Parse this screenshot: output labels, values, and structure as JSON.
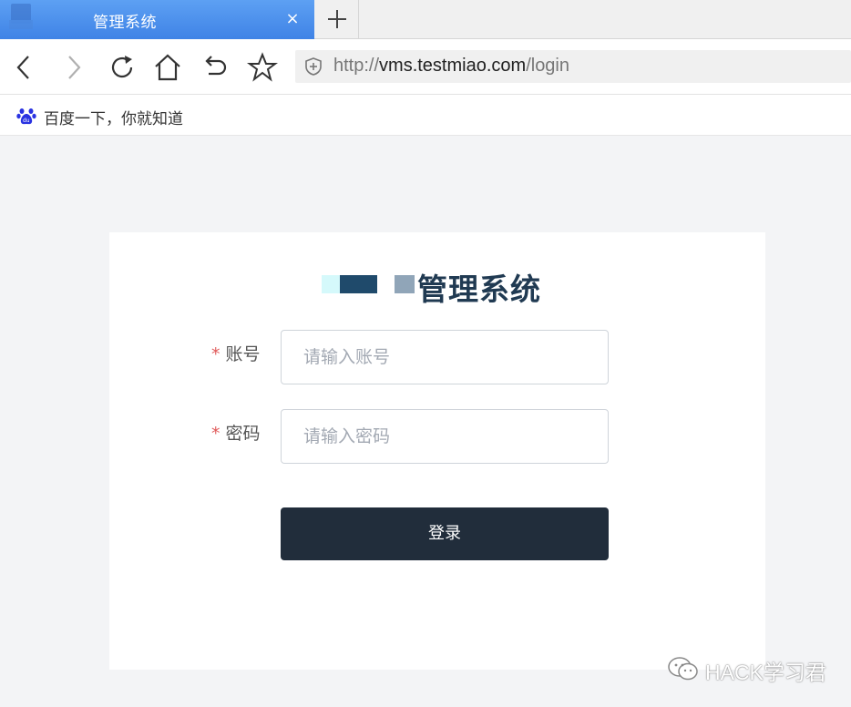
{
  "browser": {
    "tab": {
      "title": "管理系统",
      "close": "×"
    },
    "url": {
      "scheme": "http://",
      "host": "vms.testmiao.com",
      "path": "/login"
    },
    "bookmark": {
      "label": "百度一下，你就知道"
    }
  },
  "login": {
    "title": "管理系统",
    "account": {
      "label": "账号",
      "required": "*",
      "placeholder": "请输入账号",
      "value": ""
    },
    "password": {
      "label": "密码",
      "required": "*",
      "placeholder": "请输入密码",
      "value": ""
    },
    "submit": "登录"
  },
  "watermark": {
    "text": "HACK学习君"
  },
  "colors": {
    "tab": "#3f83e6",
    "button": "#212d3b",
    "title": "#203a52",
    "required": "#e05a5a"
  }
}
